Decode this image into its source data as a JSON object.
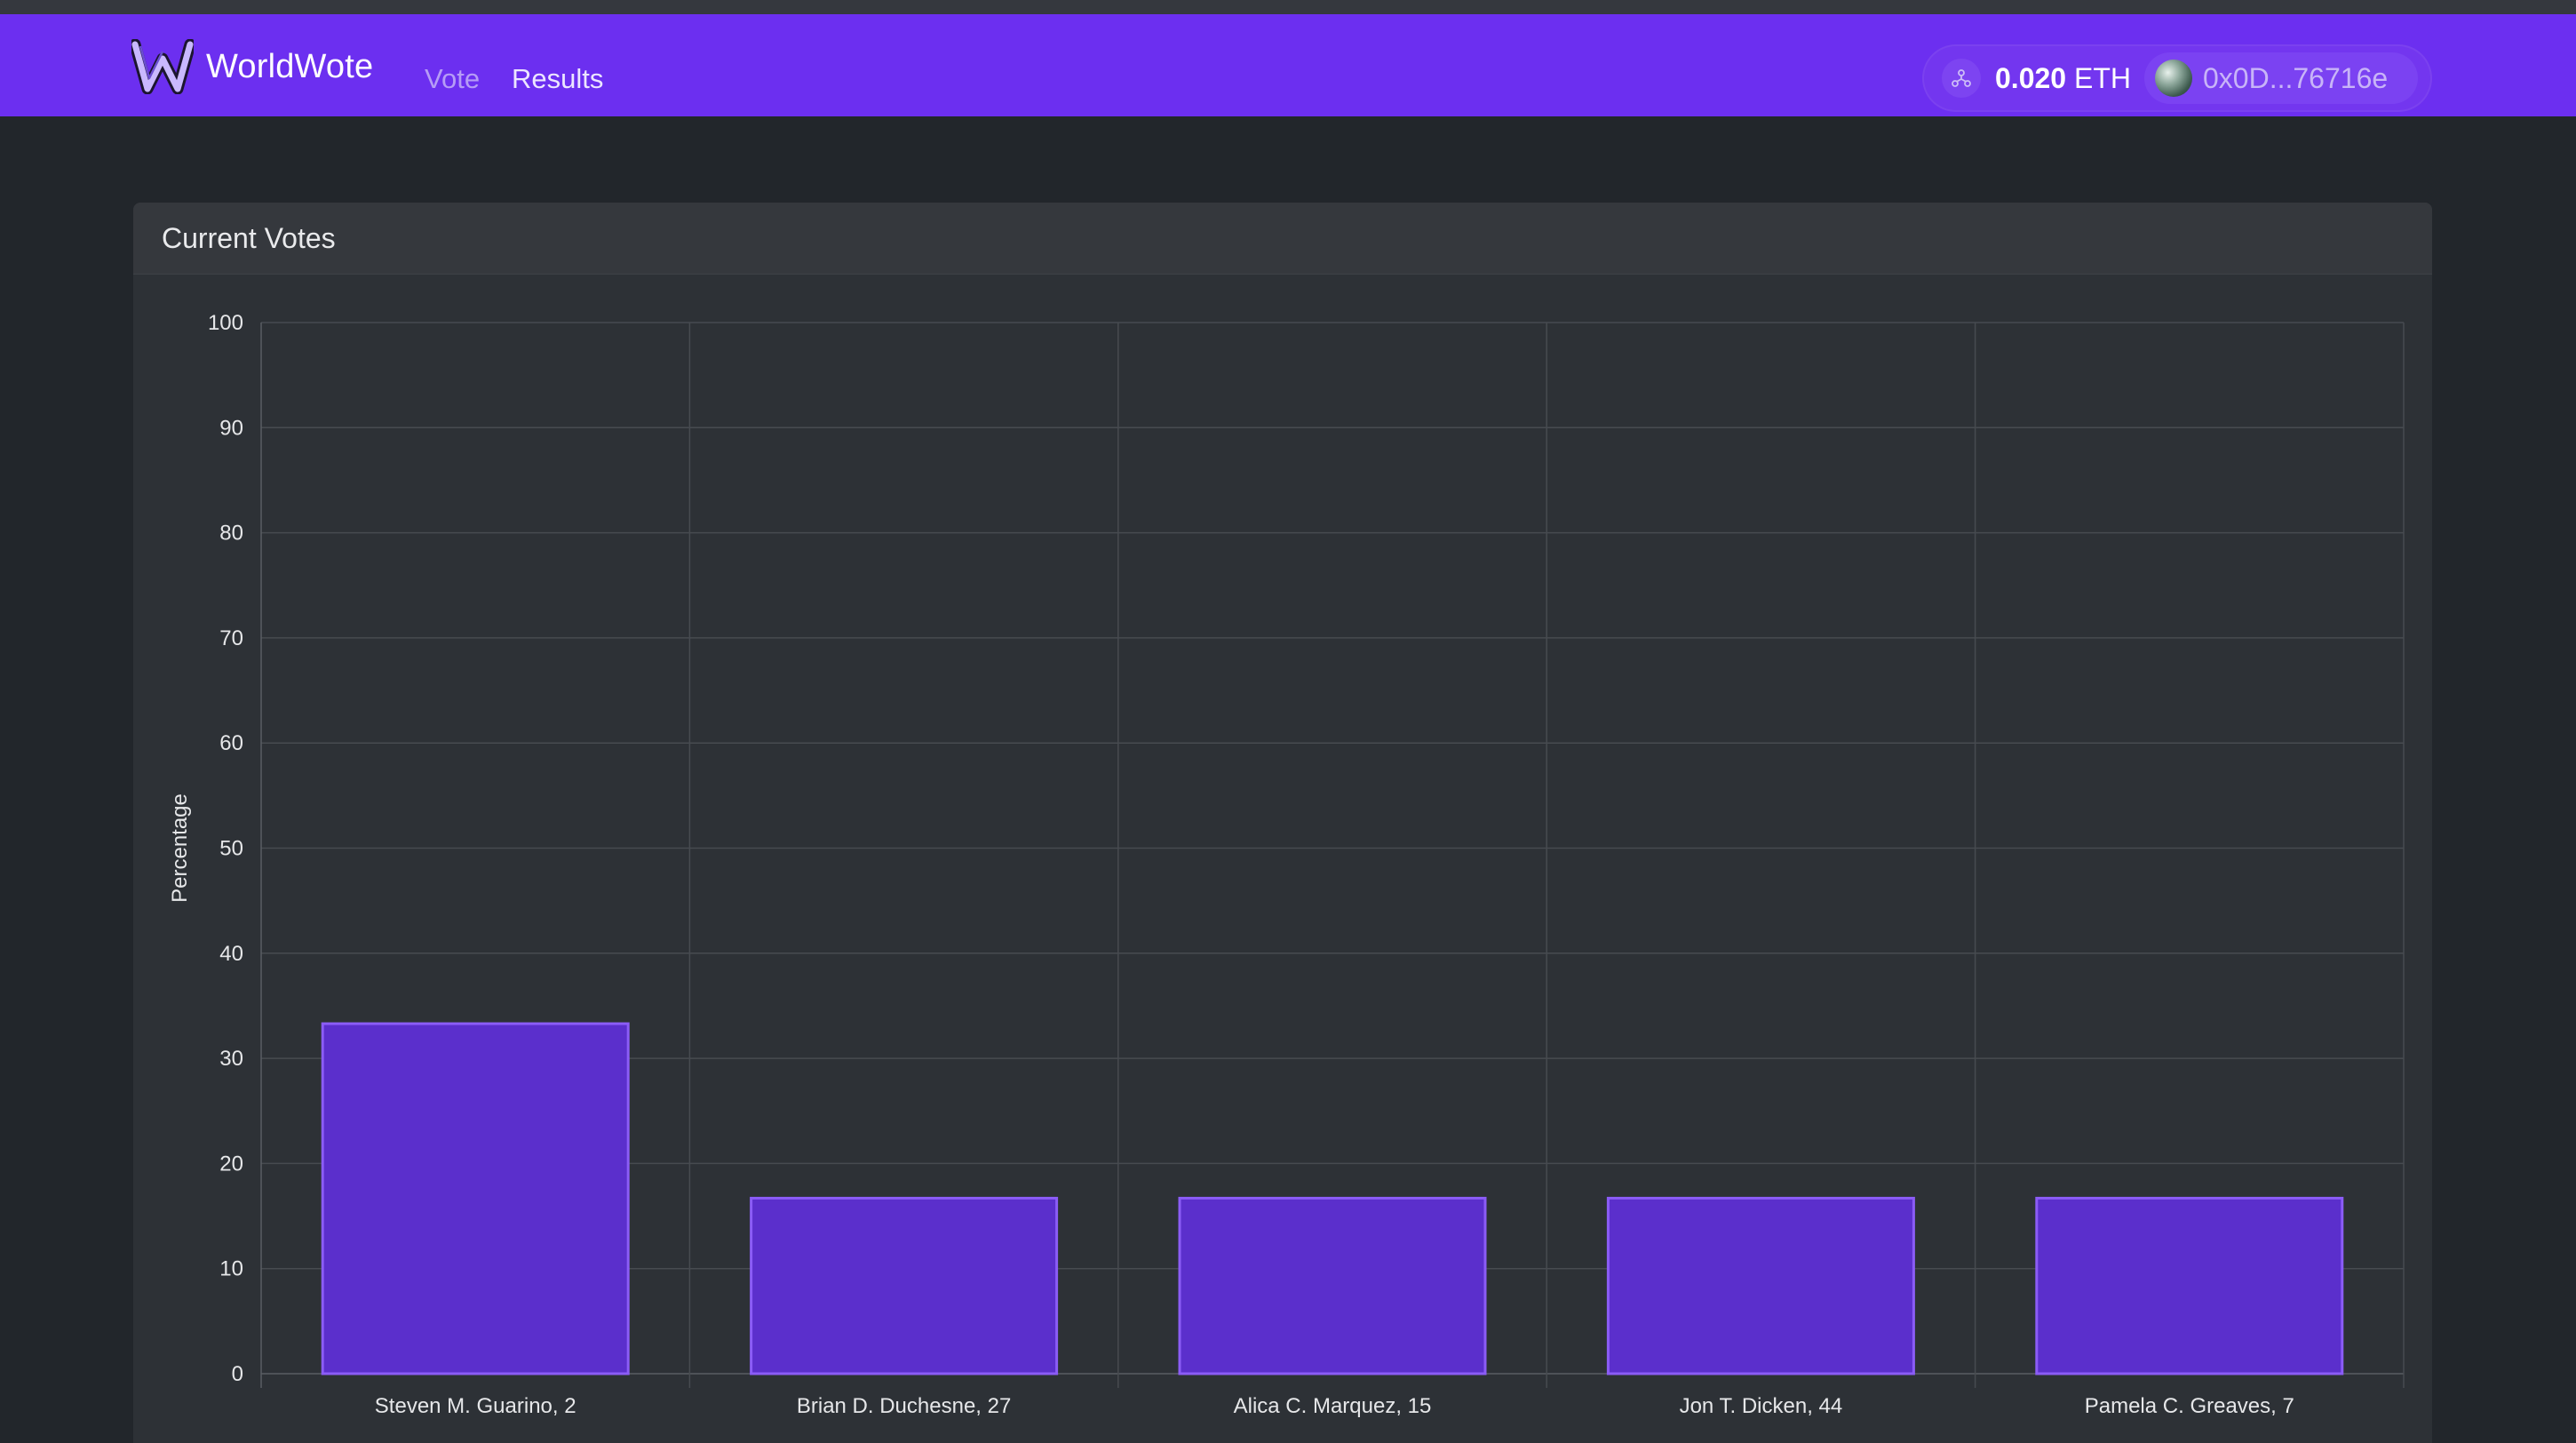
{
  "app": {
    "name": "WorldWote",
    "nav": [
      {
        "label": "Vote",
        "active": false
      },
      {
        "label": "Results",
        "active": true
      }
    ]
  },
  "wallet": {
    "network_icon": "network-icon",
    "balance_value": "0.020",
    "balance_unit": "ETH",
    "address": "0x0D...76716e"
  },
  "card": {
    "title": "Current Votes"
  },
  "colors": {
    "navbar": "#6c2ff0",
    "bar_fill": "#5b2fcc",
    "bar_border": "#8b5cf6",
    "background": "#22262b"
  },
  "chart_data": {
    "type": "bar",
    "ylabel": "Percentage",
    "xlabel": "",
    "ylim": [
      0,
      100
    ],
    "yticks": [
      0,
      10,
      20,
      30,
      40,
      50,
      60,
      70,
      80,
      90,
      100
    ],
    "grid": true,
    "categories": [
      "Steven M. Guarino, 2",
      "Brian D. Duchesne, 27",
      "Alica C. Marquez, 15",
      "Jon T. Dicken, 44",
      "Pamela C. Greaves, 7"
    ],
    "values": [
      33.3,
      16.7,
      16.7,
      16.7,
      16.7
    ]
  }
}
